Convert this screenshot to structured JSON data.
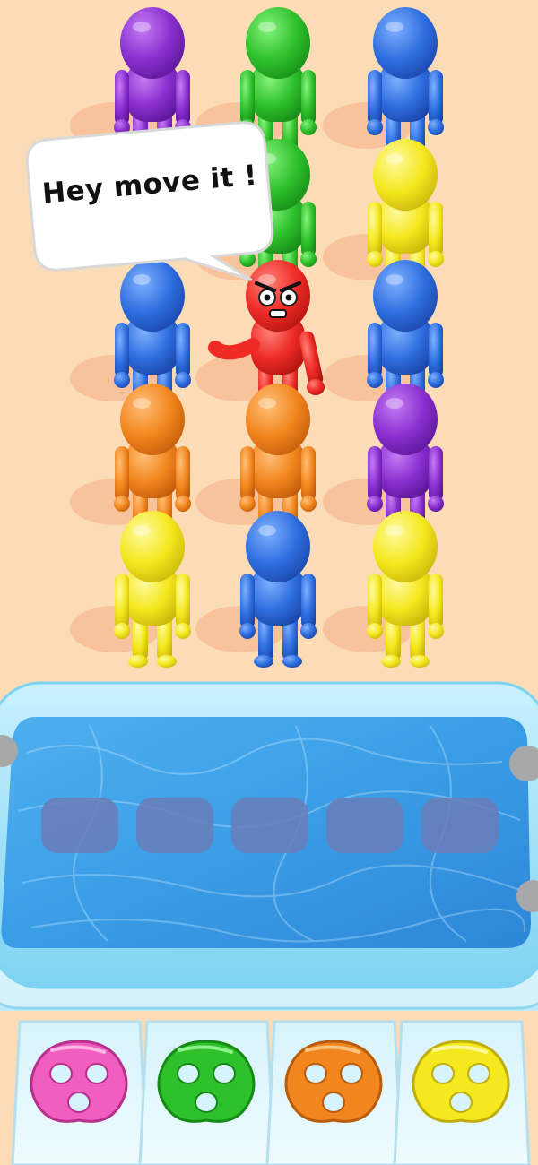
{
  "speech_bubble": {
    "text": "Hey move it !"
  },
  "colors": {
    "background": "#fbdcb6",
    "purple": "#8a2fd0",
    "green": "#2fc12c",
    "blue": "#2f6fe0",
    "yellow": "#f4e81e",
    "orange": "#f2861e",
    "red": "#ee2b26",
    "pink": "#f05fc0",
    "pool_rim": "#9ee3f8",
    "pool_water": "#3fa3ea",
    "slot": "#6a7cb8"
  },
  "crowd": {
    "rows": [
      [
        "purple",
        "green",
        "blue"
      ],
      [
        "green",
        "yellow"
      ],
      [
        "blue",
        "red-angry",
        "blue"
      ],
      [
        "orange",
        "orange",
        "purple"
      ],
      [
        "yellow",
        "blue",
        "yellow"
      ]
    ]
  },
  "pool": {
    "empty_slots": 5
  },
  "inventory": {
    "rings": [
      "pink",
      "green",
      "orange",
      "yellow"
    ]
  }
}
